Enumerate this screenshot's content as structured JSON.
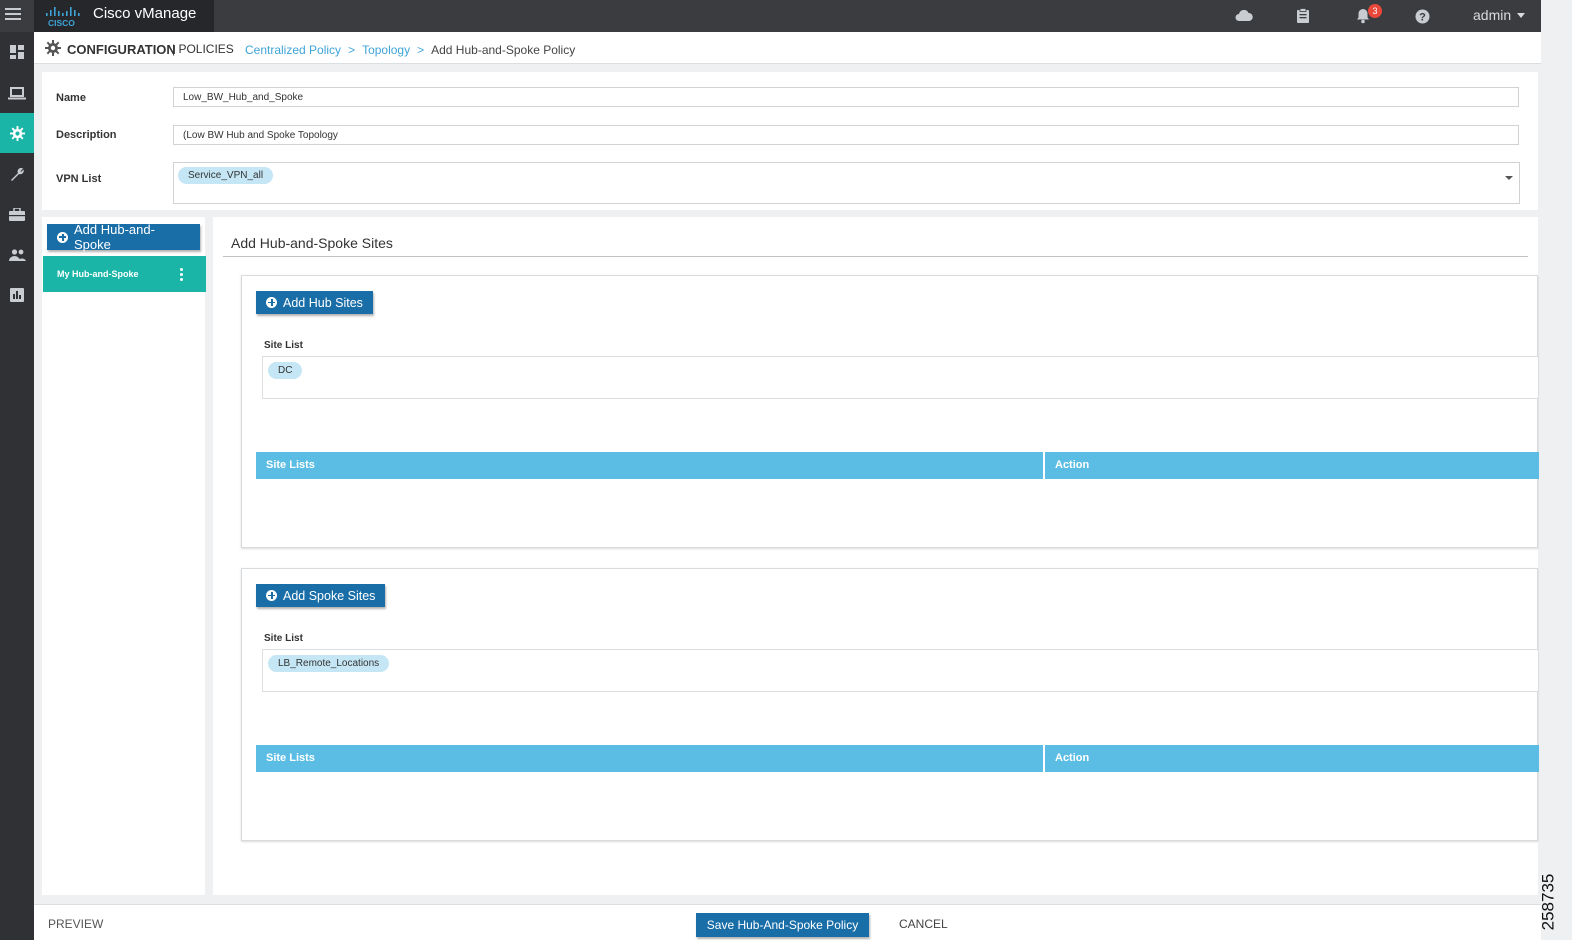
{
  "app": {
    "title": "Cisco vManage",
    "logo_text": "CISCO"
  },
  "topbar": {
    "notifications_count": "3",
    "user": "admin"
  },
  "nav": {
    "items": [
      "dashboard-icon",
      "monitor-icon",
      "configuration-icon",
      "tools-icon",
      "maintenance-icon",
      "administration-icon",
      "analytics-icon"
    ],
    "active": "configuration-icon",
    "active_color": "#1bb5a8"
  },
  "header": {
    "title": "CONFIGURATION",
    "subtitle": "| POLICIES",
    "breadcrumbs": [
      "Centralized Policy",
      "Topology",
      "Add Hub-and-Spoke Policy"
    ],
    "separator": ">"
  },
  "form": {
    "name_label": "Name",
    "name_value": "Low_BW_Hub_and_Spoke",
    "description_label": "Description",
    "description_value": "(Low BW Hub and Spoke Topology",
    "vpn_label": "VPN List",
    "vpn_tag": "Service_VPN_all"
  },
  "list_panel": {
    "add_button": "Add Hub-and-Spoke",
    "items": [
      "My Hub-and-Spoke"
    ]
  },
  "main": {
    "title": "Add Hub-and-Spoke Sites",
    "hub": {
      "button": "Add Hub Sites",
      "site_list_label": "Site List",
      "site_tag": "DC",
      "columns": [
        "Site Lists",
        "Action"
      ]
    },
    "spoke": {
      "button": "Add Spoke Sites",
      "site_list_label": "Site List",
      "site_tag": "LB_Remote_Locations",
      "columns": [
        "Site Lists",
        "Action"
      ]
    }
  },
  "footer": {
    "preview": "PREVIEW",
    "save": "Save Hub-And-Spoke Policy",
    "cancel": "CANCEL"
  },
  "figure_number": "258735",
  "colors": {
    "primary_button": "#1a6ea8",
    "teal": "#1bb5a8",
    "table_header": "#5bbde4",
    "tag": "#c5e6f5",
    "link": "#3ea4d8"
  }
}
